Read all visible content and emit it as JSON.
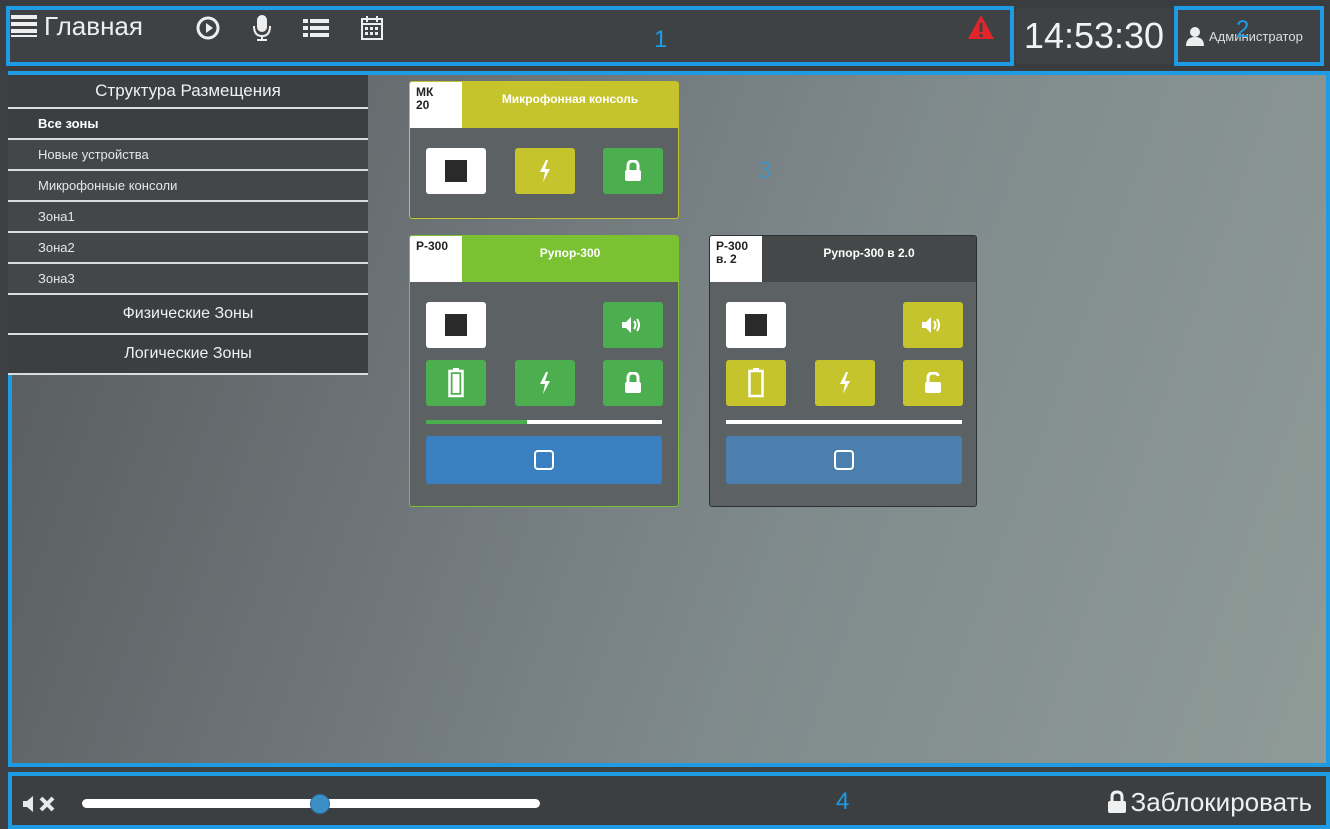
{
  "header": {
    "home_label": "Главная",
    "clock": "14:53:30",
    "user": "Администратор",
    "region_1": "1",
    "region_2": "2"
  },
  "sidebar": {
    "header": "Структура Размещения",
    "items": [
      {
        "label": "Все зоны",
        "active": true
      },
      {
        "label": "Новые устройства"
      },
      {
        "label": "Микрофонные консоли"
      },
      {
        "label": "Зона1"
      },
      {
        "label": "Зона2"
      },
      {
        "label": "Зона3"
      }
    ],
    "physical_zones": "Физические Зоны",
    "logical_zones": "Логические Зоны"
  },
  "main": {
    "region_label": "3"
  },
  "devices": [
    {
      "code_line1": "МК",
      "code_line2": "20",
      "name": "Микрофонная консоль",
      "header_color": "#c5c42c"
    },
    {
      "code_line1": "Р-300",
      "code_line2": "",
      "name": "Рупор-300",
      "header_color": "#7ac231",
      "progress": 0.43
    },
    {
      "code_line1": "Р-300",
      "code_line2": "в. 2",
      "name": "Рупор-300 в 2.0",
      "header_color": "#454849",
      "progress": 0.0
    }
  ],
  "footer": {
    "region_label": "4",
    "lock_label": "Заблокировать",
    "volume": 0.52
  },
  "colors": {
    "accent": "#1f9be3",
    "green": "#4cae4f",
    "yellow": "#c5c42c",
    "alert": "#e0262b"
  },
  "icons": [
    "list-icon",
    "play-circle-icon",
    "microphone-icon",
    "list-bullets-icon",
    "calendar-icon",
    "alert-triangle-icon",
    "user-icon",
    "stop-icon",
    "lightning-icon",
    "lock-icon",
    "speaker-icon",
    "battery-icon",
    "unlock-icon",
    "checkbox-icon",
    "speaker-mute-icon",
    "padlock-icon"
  ]
}
